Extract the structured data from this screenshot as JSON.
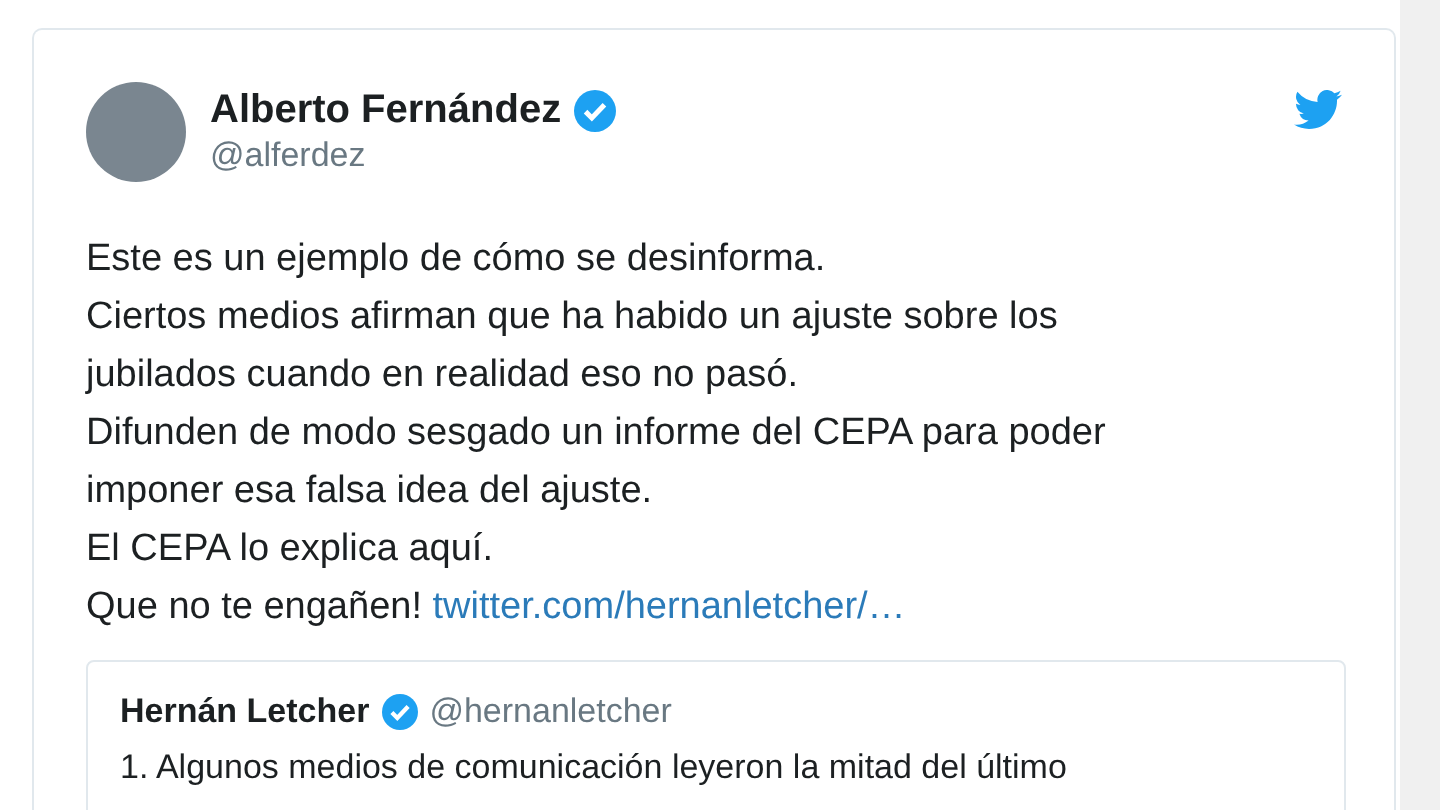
{
  "tweet": {
    "author": {
      "name": "Alberto Fernández",
      "handle": "@alferdez",
      "verified": true
    },
    "lines": [
      "Este es un ejemplo de cómo se desinforma.",
      "Ciertos medios afirman que ha habido un ajuste sobre los",
      "jubilados cuando en realidad eso no pasó.",
      "Difunden de modo sesgado un informe del CEPA para poder",
      "imponer esa falsa idea del ajuste.",
      "El CEPA lo explica aquí."
    ],
    "last_line": {
      "text": "Que no te engañen!",
      "link": "twitter.com/hernanletcher/…"
    },
    "quoted": {
      "name": "Hernán Letcher",
      "handle": "@hernanletcher",
      "verified": true,
      "text": "1. Algunos medios de comunicación leyeron la mitad del último"
    }
  }
}
